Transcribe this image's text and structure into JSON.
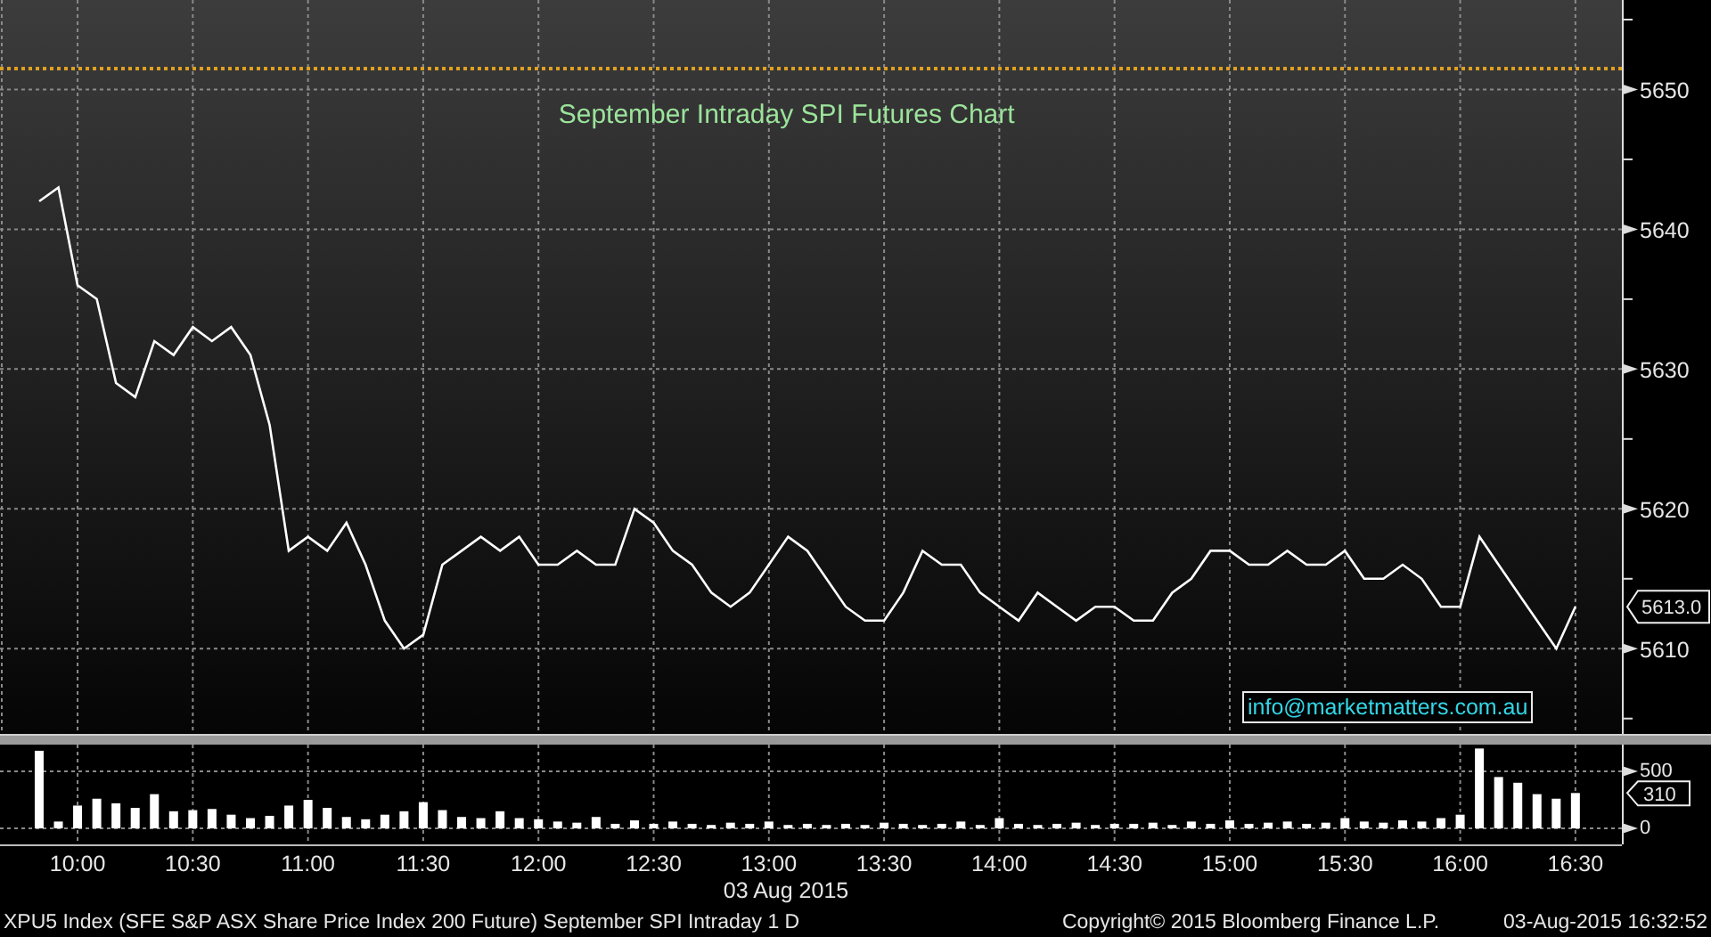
{
  "price_chart": {
    "chart_data": {
      "type": "line",
      "title": "September Intraday SPI Futures Chart",
      "categories": [
        null,
        null,
        null,
        null,
        null,
        null,
        null,
        null,
        null,
        null,
        null,
        null,
        null,
        null,
        null,
        null,
        null,
        null,
        null,
        null,
        null,
        null,
        null,
        null,
        null,
        null,
        null,
        null,
        null,
        null,
        null,
        null,
        null,
        null,
        null,
        null,
        null,
        null,
        null,
        null,
        null,
        null,
        null,
        null,
        null,
        null,
        null,
        null,
        null,
        null,
        null,
        null,
        null,
        null,
        null,
        null,
        null,
        null,
        null,
        null,
        null,
        null,
        null,
        null,
        null,
        null,
        null,
        null,
        null,
        null,
        null,
        null,
        null,
        null,
        null,
        null,
        null,
        null,
        null,
        null,
        null
      ],
      "series": [
        {
          "color": "#ffffff",
          "values": [
            5642,
            5643,
            5636,
            5635,
            5629,
            5628,
            5632,
            5631,
            5633,
            5632,
            5633,
            5631,
            5626,
            5617,
            5618,
            5617,
            5619,
            5616,
            5612,
            5610,
            5611,
            5616,
            5617,
            5618,
            5617,
            5618,
            5616,
            5616,
            5617,
            5616,
            5616,
            5620,
            5619,
            5617,
            5616,
            5614,
            5613,
            5614,
            5616,
            5618,
            5617,
            5615,
            5613,
            5612,
            5612,
            5614,
            5617,
            5616,
            5616,
            5614,
            5613,
            5612,
            5614,
            5613,
            5612,
            5613,
            5613,
            5612,
            5612,
            5614,
            5615,
            5617,
            5617,
            5616,
            5616,
            5617,
            5616,
            5616,
            5617,
            5615,
            5615,
            5616,
            5615,
            5613,
            5613,
            5618,
            5616,
            5614,
            5612,
            5610,
            5613
          ]
        }
      ],
      "ylim": [
        5603.9,
        5656.4
      ],
      "grid": true,
      "yticks": [
        {
          "value": 5610,
          "label": "5610"
        },
        {
          "value": 5620,
          "label": "5620"
        },
        {
          "value": 5630,
          "label": "5630"
        },
        {
          "value": 5640,
          "label": "5640"
        },
        {
          "value": 5650,
          "label": "5650"
        }
      ],
      "ref_lines": [
        {
          "axis": "y",
          "value": 5651.5,
          "color": "#e0a020"
        }
      ],
      "annotations": [
        "5613.0"
      ]
    },
    "contact_box": "info@marketmatters.com.au"
  },
  "volume_chart": {
    "chart_data": {
      "type": "bar",
      "xlabel": "03 Aug 2015",
      "x": [
        590,
        595,
        600,
        605,
        610,
        615,
        620,
        625,
        630,
        635,
        640,
        645,
        650,
        655,
        660,
        665,
        670,
        675,
        680,
        685,
        690,
        695,
        700,
        705,
        710,
        715,
        720,
        725,
        730,
        735,
        740,
        745,
        750,
        755,
        760,
        765,
        770,
        775,
        780,
        785,
        790,
        795,
        800,
        805,
        810,
        815,
        820,
        825,
        830,
        835,
        840,
        845,
        850,
        855,
        860,
        865,
        870,
        875,
        880,
        885,
        890,
        895,
        900,
        905,
        910,
        915,
        920,
        925,
        930,
        935,
        940,
        945,
        950,
        955,
        960,
        965,
        970,
        975,
        980,
        985,
        990
      ],
      "series": [
        {
          "color": "#ffffff",
          "values": [
            680,
            60,
            200,
            260,
            220,
            180,
            300,
            150,
            160,
            170,
            120,
            90,
            110,
            200,
            250,
            180,
            100,
            80,
            120,
            150,
            230,
            160,
            100,
            90,
            150,
            90,
            80,
            60,
            50,
            100,
            40,
            70,
            40,
            60,
            40,
            30,
            50,
            40,
            60,
            30,
            40,
            30,
            40,
            30,
            50,
            40,
            30,
            40,
            60,
            30,
            90,
            40,
            30,
            40,
            50,
            30,
            40,
            40,
            50,
            30,
            60,
            40,
            70,
            40,
            50,
            60,
            40,
            50,
            90,
            60,
            50,
            70,
            60,
            90,
            120,
            700,
            450,
            400,
            300,
            260,
            310
          ]
        }
      ],
      "xlim": [
        579.8,
        1002.1
      ],
      "ylim": [
        -140,
        734
      ],
      "grid": true,
      "xticks": [
        {
          "value": 600,
          "label": "10:00"
        },
        {
          "value": 630,
          "label": "10:30"
        },
        {
          "value": 660,
          "label": "11:00"
        },
        {
          "value": 690,
          "label": "11:30"
        },
        {
          "value": 720,
          "label": "12:00"
        },
        {
          "value": 750,
          "label": "12:30"
        },
        {
          "value": 780,
          "label": "13:00"
        },
        {
          "value": 810,
          "label": "13:30"
        },
        {
          "value": 840,
          "label": "14:00"
        },
        {
          "value": 870,
          "label": "14:30"
        },
        {
          "value": 900,
          "label": "15:00"
        },
        {
          "value": 930,
          "label": "15:30"
        },
        {
          "value": 960,
          "label": "16:00"
        },
        {
          "value": 990,
          "label": "16:30"
        }
      ],
      "yticks": [
        {
          "value": 0,
          "label": "0"
        },
        {
          "value": 500,
          "label": "500"
        }
      ],
      "annotations": [
        "310"
      ]
    }
  },
  "footer": {
    "security": "XPU5 Index (SFE S&P ASX Share Price Index 200 Future) September SPI Intraday 1 D",
    "copyright": "Copyright© 2015 Bloomberg Finance L.P.",
    "timestamp": "03-Aug-2015 16:32:52"
  }
}
